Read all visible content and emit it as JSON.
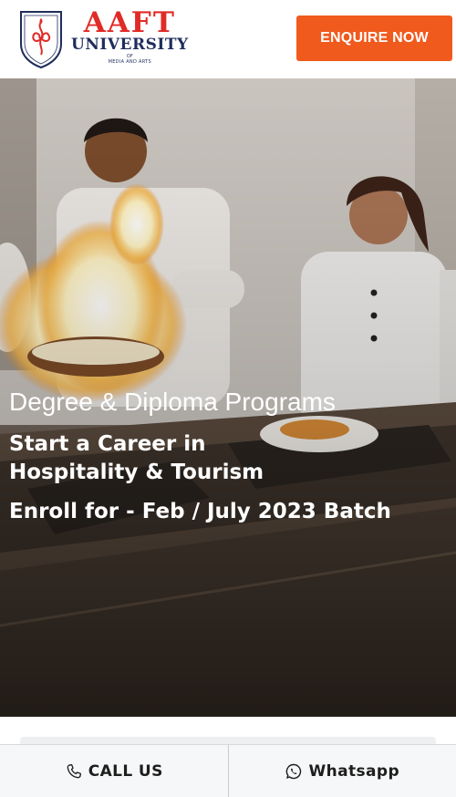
{
  "header": {
    "logo": {
      "brand": "AAFT",
      "university": "UNIVERSITY",
      "of": "OF",
      "media_arts": "MEDIA AND ARTS"
    },
    "enquire_label": "ENQUIRE NOW",
    "accent_color": "#f05a1d"
  },
  "hero": {
    "programs": "Degree & Diploma Programs",
    "career_line1": "Start a Career in",
    "career_line2": "Hospitality & Tourism",
    "enroll": "Enroll for - Feb / July 2023 Batch"
  },
  "bottom_bar": {
    "call_label": "CALL US",
    "call_icon": "phone-icon",
    "whatsapp_label": "Whatsapp",
    "whatsapp_icon": "whatsapp-icon"
  }
}
